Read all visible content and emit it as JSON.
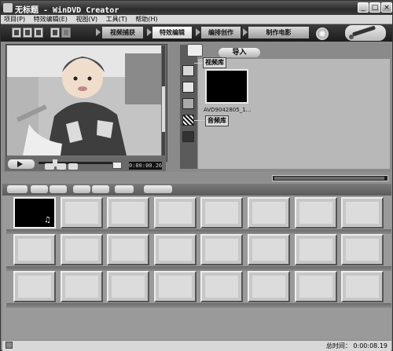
{
  "window": {
    "title": "无标题 - WinDVD Creator",
    "buttons": {
      "minimize": "_",
      "maximize": "□",
      "close": "×"
    }
  },
  "menu": {
    "items": [
      {
        "label": "项目(P)"
      },
      {
        "label": "特效编辑(E)"
      },
      {
        "label": "视图(V)"
      },
      {
        "label": "工具(T)"
      },
      {
        "label": "帮助(H)"
      }
    ]
  },
  "steps": [
    {
      "label": "视频捕获"
    },
    {
      "label": "特效编辑"
    },
    {
      "label": "编排创作"
    },
    {
      "label": "制作电影"
    }
  ],
  "preview": {
    "timecode": "0:00:00.26"
  },
  "library": {
    "import_label": "导入",
    "video_lib_tip": "视频库",
    "audio_lib_tip": "音频库",
    "clip_name": "AVD9042805_1...",
    "icons": [
      "folder-icon",
      "image-icon",
      "music-icon",
      "transition-icon",
      "text-icon"
    ]
  },
  "storyboard": {
    "rows": 3,
    "cols": 8,
    "filled_slot": 0
  },
  "status": {
    "total_time": "总时间： 0:00:08.19"
  }
}
